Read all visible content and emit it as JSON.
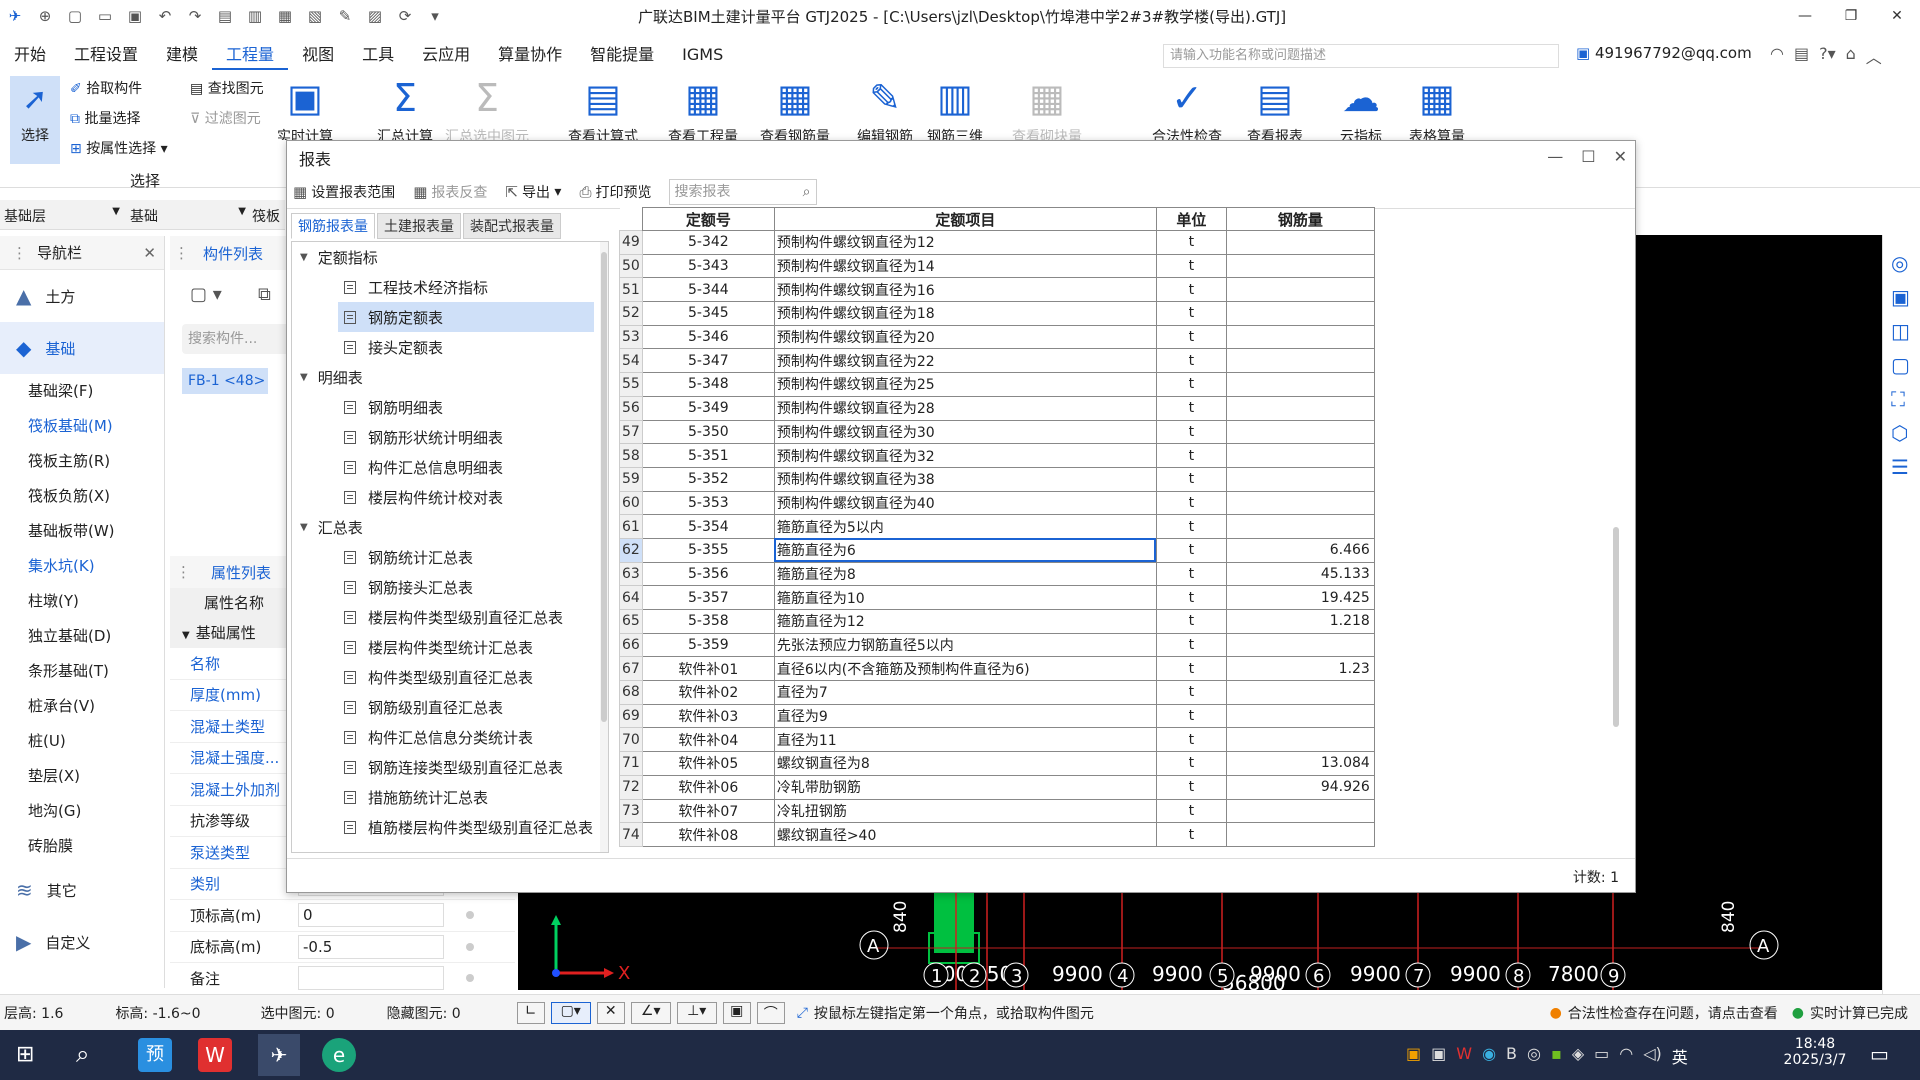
{
  "app": {
    "title": "广联达BIM土建计量平台 GTJ2025 - [C:\\Users\\jzl\\Desktop\\竹埠港中学2#3#教学楼(导出).GTJ]"
  },
  "menu": {
    "items": [
      "开始",
      "工程设置",
      "建模",
      "工程量",
      "视图",
      "工具",
      "云应用",
      "算量协作",
      "智能提量",
      "IGMS"
    ],
    "active_index": 3,
    "search_placeholder": "请输入功能名称或问题描述",
    "user_email": "491967792@qq.com"
  },
  "ribbon": {
    "select_label": "选择",
    "pick": "拾取构件",
    "batch": "批量选择",
    "by_attr": "按属性选择",
    "find": "查找图元",
    "filter": "过滤图元",
    "group_select": "选择",
    "big_buttons": [
      "实时计算",
      "汇总计算",
      "汇总选中图元",
      "查看计算式",
      "查看工程量",
      "查看钢筋量",
      "编辑钢筋",
      "钢筋三维",
      "查看砌块量",
      "合法性检查",
      "查看报表",
      "云指标",
      "表格算量"
    ]
  },
  "floorbar": {
    "floor": "基础层",
    "type": "基础",
    "sub": "筏板"
  },
  "nav": {
    "title": "导航栏",
    "groups": [
      {
        "label": "土方"
      },
      {
        "label": "基础"
      },
      {
        "label": "其它"
      },
      {
        "label": "自定义"
      }
    ],
    "items": [
      "基础梁(F)",
      "筏板基础(M)",
      "筏板主筋(R)",
      "筏板负筋(X)",
      "基础板带(W)",
      "集水坑(K)",
      "柱墩(Y)",
      "独立基础(D)",
      "条形基础(T)",
      "桩承台(V)",
      "桩(U)",
      "垫层(X)",
      "地沟(G)",
      "砖胎膜"
    ]
  },
  "complist": {
    "title": "构件列表",
    "search_placeholder": "搜索构件...",
    "item": "FB-1 <48>"
  },
  "props": {
    "title": "属性列表",
    "header": "属性名称",
    "group": "基础属性",
    "rows": [
      {
        "name": "名称",
        "value": ""
      },
      {
        "name": "厚度(mm)",
        "value": ""
      },
      {
        "name": "混凝土类型",
        "value": ""
      },
      {
        "name": "混凝土强度...",
        "value": ""
      },
      {
        "name": "混凝土外加剂",
        "value": ""
      },
      {
        "name": "抗渗等级",
        "value": ""
      },
      {
        "name": "泵送类型",
        "value": ""
      },
      {
        "name": "类别",
        "value": ""
      },
      {
        "name": "顶标高(m)",
        "value": "0"
      },
      {
        "name": "底标高(m)",
        "value": "-0.5"
      },
      {
        "name": "备注",
        "value": ""
      }
    ]
  },
  "report": {
    "title": "报表",
    "toolbar": {
      "range": "设置报表范围",
      "check": "报表反查",
      "export": "导出",
      "print": "打印预览",
      "search_placeholder": "搜索报表"
    },
    "tabs": [
      "钢筋报表量",
      "土建报表量",
      "装配式报表量"
    ],
    "tree": [
      {
        "group": "定额指标",
        "items": [
          "工程技术经济指标",
          "钢筋定额表",
          "接头定额表"
        ]
      },
      {
        "group": "明细表",
        "items": [
          "钢筋明细表",
          "钢筋形状统计明细表",
          "构件汇总信息明细表",
          "楼层构件统计校对表"
        ]
      },
      {
        "group": "汇总表",
        "items": [
          "钢筋统计汇总表",
          "钢筋接头汇总表",
          "楼层构件类型级别直径汇总表",
          "楼层构件类型统计汇总表",
          "构件类型级别直径汇总表",
          "钢筋级别直径汇总表",
          "构件汇总信息分类统计表",
          "钢筋连接类型级别直径汇总表",
          "措施筋统计汇总表",
          "植筋楼层构件类型级别直径汇总表"
        ]
      }
    ],
    "columns": [
      "定额号",
      "定额项目",
      "单位",
      "钢筋量"
    ],
    "rows": [
      {
        "n": "49",
        "code": "5-342",
        "item": "预制构件螺纹钢直径为12",
        "unit": "t",
        "qty": ""
      },
      {
        "n": "50",
        "code": "5-343",
        "item": "预制构件螺纹钢直径为14",
        "unit": "t",
        "qty": ""
      },
      {
        "n": "51",
        "code": "5-344",
        "item": "预制构件螺纹钢直径为16",
        "unit": "t",
        "qty": ""
      },
      {
        "n": "52",
        "code": "5-345",
        "item": "预制构件螺纹钢直径为18",
        "unit": "t",
        "qty": ""
      },
      {
        "n": "53",
        "code": "5-346",
        "item": "预制构件螺纹钢直径为20",
        "unit": "t",
        "qty": ""
      },
      {
        "n": "54",
        "code": "5-347",
        "item": "预制构件螺纹钢直径为22",
        "unit": "t",
        "qty": ""
      },
      {
        "n": "55",
        "code": "5-348",
        "item": "预制构件螺纹钢直径为25",
        "unit": "t",
        "qty": ""
      },
      {
        "n": "56",
        "code": "5-349",
        "item": "预制构件螺纹钢直径为28",
        "unit": "t",
        "qty": ""
      },
      {
        "n": "57",
        "code": "5-350",
        "item": "预制构件螺纹钢直径为30",
        "unit": "t",
        "qty": ""
      },
      {
        "n": "58",
        "code": "5-351",
        "item": "预制构件螺纹钢直径为32",
        "unit": "t",
        "qty": ""
      },
      {
        "n": "59",
        "code": "5-352",
        "item": "预制构件螺纹钢直径为38",
        "unit": "t",
        "qty": ""
      },
      {
        "n": "60",
        "code": "5-353",
        "item": "预制构件螺纹钢直径为40",
        "unit": "t",
        "qty": ""
      },
      {
        "n": "61",
        "code": "5-354",
        "item": "箍筋直径为5以内",
        "unit": "t",
        "qty": ""
      },
      {
        "n": "62",
        "code": "5-355",
        "item": "箍筋直径为6",
        "unit": "t",
        "qty": "6.466"
      },
      {
        "n": "63",
        "code": "5-356",
        "item": "箍筋直径为8",
        "unit": "t",
        "qty": "45.133"
      },
      {
        "n": "64",
        "code": "5-357",
        "item": "箍筋直径为10",
        "unit": "t",
        "qty": "19.425"
      },
      {
        "n": "65",
        "code": "5-358",
        "item": "箍筋直径为12",
        "unit": "t",
        "qty": "1.218"
      },
      {
        "n": "66",
        "code": "5-359",
        "item": "先张法预应力钢筋直径5以内",
        "unit": "t",
        "qty": ""
      },
      {
        "n": "67",
        "code": "软件补01",
        "item": "直径6以内(不含箍筋及预制构件直径为6)",
        "unit": "t",
        "qty": "1.23"
      },
      {
        "n": "68",
        "code": "软件补02",
        "item": "直径为7",
        "unit": "t",
        "qty": ""
      },
      {
        "n": "69",
        "code": "软件补03",
        "item": "直径为9",
        "unit": "t",
        "qty": ""
      },
      {
        "n": "70",
        "code": "软件补04",
        "item": "直径为11",
        "unit": "t",
        "qty": ""
      },
      {
        "n": "71",
        "code": "软件补05",
        "item": "螺纹钢直径为8",
        "unit": "t",
        "qty": "13.084"
      },
      {
        "n": "72",
        "code": "软件补06",
        "item": "冷轧带肋钢筋",
        "unit": "t",
        "qty": "94.926"
      },
      {
        "n": "73",
        "code": "软件补07",
        "item": "冷轧扭钢筋",
        "unit": "t",
        "qty": ""
      },
      {
        "n": "74",
        "code": "软件补08",
        "item": "螺纹钢直径>40",
        "unit": "t",
        "qty": ""
      }
    ],
    "count_label": "计数: 1"
  },
  "cad": {
    "axis_labels": [
      "A",
      "A"
    ],
    "dims": [
      "4000",
      "4500",
      "9900",
      "9900",
      "9900",
      "9900",
      "9900",
      "7800",
      "840",
      "840",
      "56800"
    ],
    "axis_numbers": [
      "1",
      "2",
      "3",
      "4",
      "5",
      "6",
      "7",
      "8",
      "9"
    ],
    "axis_x": "X"
  },
  "status": {
    "floor_h": "层高: 1.6",
    "elev": "标高: -1.6~0",
    "selected": "选中图元: 0",
    "hidden": "隐藏图元: 0",
    "hint": "按鼠标左键指定第一个角点，或拾取构件图元",
    "legal": "合法性检查存在问题，请点击查看",
    "realtime": "实时计算已完成"
  },
  "taskbar": {
    "time": "18:48",
    "date": "2025/3/7",
    "lang": "英"
  },
  "colors": {
    "accent": "#1b63d3",
    "selected_row": "#cfe0f8",
    "cad_bg": "#000000",
    "taskbar": "#1f2a44"
  }
}
